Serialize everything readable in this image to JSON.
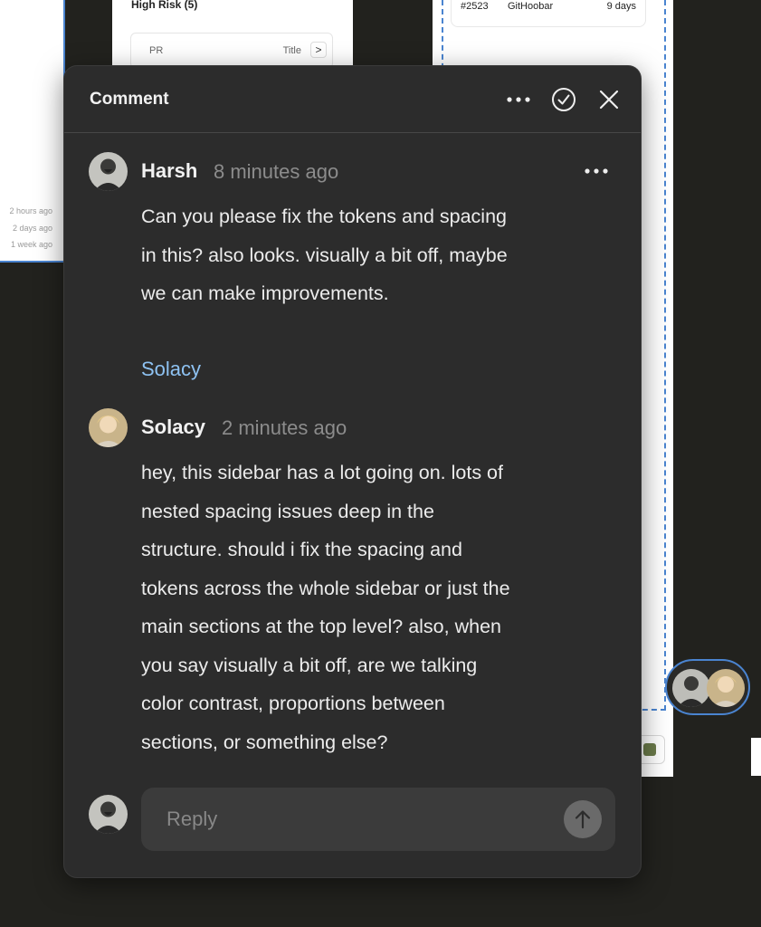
{
  "canvas": {
    "left_frame": {
      "timestamps": [
        "2 hours ago",
        "2 days ago",
        "1 week ago"
      ]
    },
    "risk_card": {
      "title": "High Risk (5)",
      "col_pr": "PR",
      "col_title": "Title",
      "chevron": ">"
    },
    "pr_row": {
      "number": "#2523",
      "author": "GitHoobar",
      "age": "9 days"
    }
  },
  "panel": {
    "title": "Comment",
    "icons": {
      "more": "more-horizontal-icon",
      "resolve": "check-circle-icon",
      "close": "close-icon"
    },
    "comments": [
      {
        "author": "Harsh",
        "time": "8 minutes ago",
        "body": [
          "Can you please fix the tokens and spacing",
          "in this? also looks. visually a bit off, maybe",
          "we can make improvements."
        ]
      },
      {
        "author": "Solacy",
        "time": "2 minutes ago",
        "body": [
          "hey, this sidebar has a lot going on. lots of",
          "nested spacing issues deep in the",
          "structure. should i fix the spacing and",
          "tokens across the whole sidebar or just the",
          "main sections at the top level? also, when",
          "you say visually a bit off, are we talking",
          "color contrast, proportions between",
          "sections, or something else?"
        ]
      }
    ],
    "mention": "Solacy",
    "reply": {
      "placeholder": "Reply",
      "value": ""
    }
  },
  "colors": {
    "panel_bg": "#2c2c2c",
    "mention": "#8ec2f2",
    "selection": "#4a84d0",
    "canvas_bg": "#22221e"
  }
}
